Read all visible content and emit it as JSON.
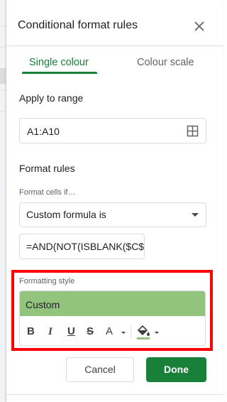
{
  "panel": {
    "title": "Conditional format rules",
    "close_icon": "close-icon"
  },
  "tabs": [
    {
      "label": "Single colour",
      "active": true
    },
    {
      "label": "Colour scale",
      "active": false
    }
  ],
  "apply_to_range": {
    "label": "Apply to range",
    "value": "A1:A10",
    "icon": "grid-select-icon"
  },
  "format_rules": {
    "label": "Format rules",
    "condition_label": "Format cells if…",
    "condition_value": "Custom formula is",
    "formula_value": "=AND(NOT(ISBLANK($C$"
  },
  "formatting_style": {
    "label": "Formatting style",
    "preview_text": "Custom",
    "preview_color": "#93c47d",
    "tools": {
      "bold": "B",
      "italic": "I",
      "underline": "U",
      "strikethrough": "S",
      "text_color": "A"
    }
  },
  "actions": {
    "cancel_label": "Cancel",
    "done_label": "Done"
  },
  "colors": {
    "accent": "#188038",
    "highlight_border": "#ff0000"
  }
}
